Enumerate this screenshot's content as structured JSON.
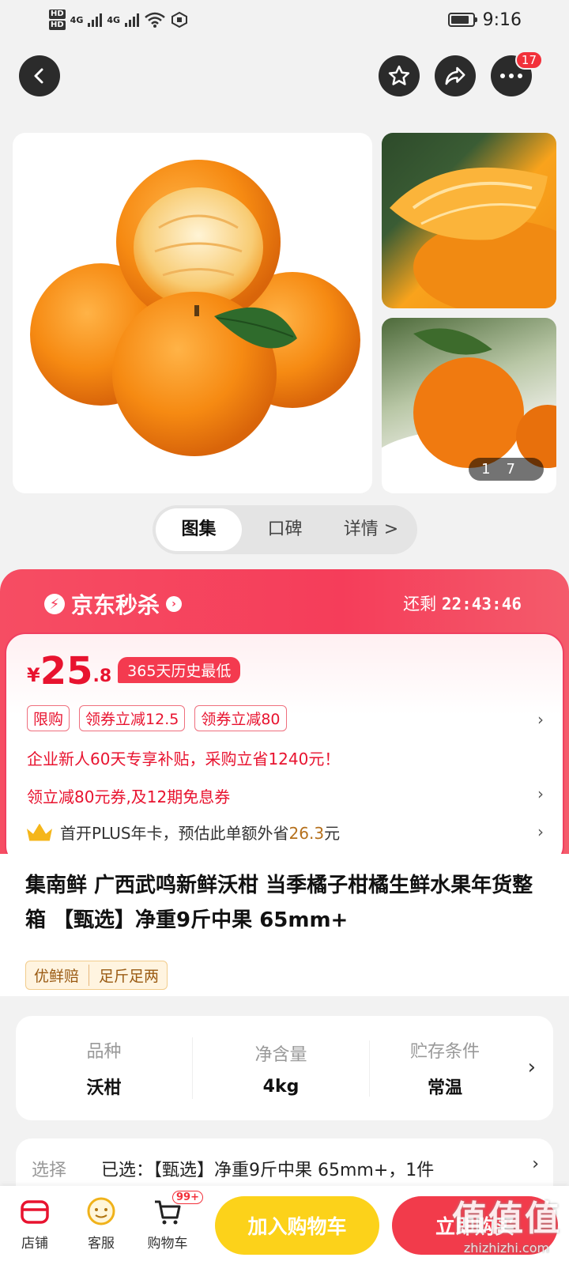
{
  "status_bar": {
    "time": "9:16",
    "net1": "4G",
    "net2": "4G",
    "hd1": "HD",
    "hd2": "HD"
  },
  "top_actions": {
    "back_icon": "chevron-left-icon",
    "favorite_icon": "star-icon",
    "share_icon": "share-icon",
    "more_icon": "more-icon",
    "message_count": "17"
  },
  "gallery": {
    "image_index": "1",
    "image_total": "7"
  },
  "gallery_tabs": [
    {
      "label": "图集",
      "active": true
    },
    {
      "label": "口碑",
      "active": false
    },
    {
      "label": "详情 >",
      "active": false
    }
  ],
  "flash_sale": {
    "title": "京东秒杀",
    "remaining_label": "还剩",
    "remaining_time": "22:43:46"
  },
  "price": {
    "currency": "¥",
    "integer": "25",
    "decimal": ".8",
    "lowest_tag": "365天历史最低"
  },
  "promo_tags": [
    "限购",
    "领券立减12.5",
    "领券立减80"
  ],
  "promos": {
    "enterprise": "企业新人60天专享补贴，采购立省1240元！",
    "coupon": "领立减80元券,及12期免息券",
    "plus_prefix": "首开PLUS年卡，预估此单额外省",
    "plus_amount": "26.3",
    "plus_suffix": "元"
  },
  "product": {
    "title": "集南鲜 广西武鸣新鲜沃柑 当季橘子柑橘生鲜水果年货整箱 【甄选】净重9斤中果 65mm+",
    "badges": [
      "优鲜赔",
      "足斤足两"
    ]
  },
  "specs": [
    {
      "label": "品种",
      "value": "沃柑"
    },
    {
      "label": "净含量",
      "value": "4kg"
    },
    {
      "label": "贮存条件",
      "value": "常温"
    }
  ],
  "selection": {
    "label": "选择",
    "value": "已选：【甄选】净重9斤中果 65mm+，1件"
  },
  "bottom_bar": {
    "store": "店铺",
    "service": "客服",
    "cart": "购物车",
    "cart_badge": "99+",
    "add_cart": "加入购物车",
    "buy_now": "立即购买"
  },
  "watermark": {
    "big": "值值值",
    "small": "zhizhizhi.com"
  },
  "colors": {
    "accent_red": "#f23b4b",
    "price_red": "#e8132f",
    "cart_yellow": "#fcd21a"
  }
}
